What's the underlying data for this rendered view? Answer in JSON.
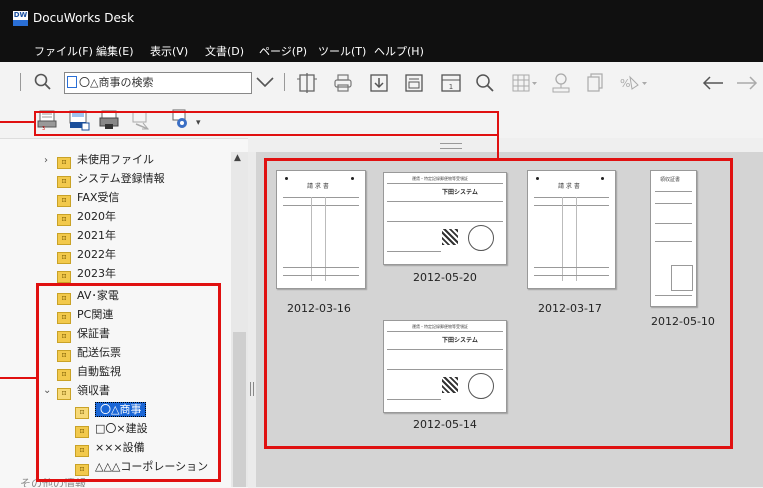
{
  "window": {
    "title": "DocuWorks Desk",
    "app_icon_text": "DW"
  },
  "menu": [
    {
      "label": "ファイル(F)"
    },
    {
      "label": "編集(E)"
    },
    {
      "label": "表示(V)"
    },
    {
      "label": "文書(D)"
    },
    {
      "label": "ページ(P)"
    },
    {
      "label": "ツール(T)"
    },
    {
      "label": "ヘルプ(H)"
    }
  ],
  "search": {
    "value": "〇△商事の検索"
  },
  "tree": {
    "items": [
      {
        "label": "未使用ファイル",
        "expander": "›"
      },
      {
        "label": "システム登録情報"
      },
      {
        "label": "FAX受信"
      },
      {
        "label": "2020年"
      },
      {
        "label": "2021年"
      },
      {
        "label": "2022年"
      },
      {
        "label": "2023年"
      },
      {
        "label": "AV･家電"
      },
      {
        "label": "PC関連"
      },
      {
        "label": "保証書"
      },
      {
        "label": "配送伝票"
      },
      {
        "label": "自動監視"
      },
      {
        "label": "領収書",
        "expander": "⌄"
      },
      {
        "label": "〇△商事"
      },
      {
        "label": "□〇×建設"
      },
      {
        "label": "×××設備"
      },
      {
        "label": "△△△コーポレーション"
      }
    ],
    "partial_bottom": "その他の情報"
  },
  "documents": [
    {
      "label": "2012-03-16",
      "type": "invoice"
    },
    {
      "label": "2012-05-20",
      "type": "slip"
    },
    {
      "label": "2012-03-17",
      "type": "invoice"
    },
    {
      "label": "2012-05-10",
      "type": "receipt"
    },
    {
      "label": "2012-05-14",
      "type": "slip"
    }
  ],
  "thumb_text": {
    "invoice_title": "請 求 書",
    "slip_header": "運賃・特定記録郵便物等受領証",
    "slip_brand": "下田システム",
    "receipt_title": "領収証書",
    "stamp": "受領印"
  },
  "colors": {
    "highlight": "#e01010",
    "titlebar": "#101010",
    "selection": "#1a66d6"
  }
}
